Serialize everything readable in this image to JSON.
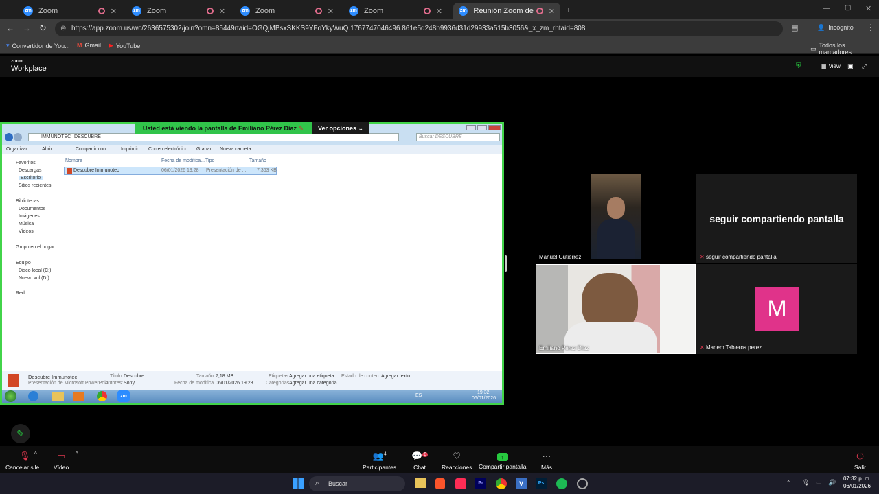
{
  "browser": {
    "tabs": [
      {
        "label": "Zoom"
      },
      {
        "label": "Zoom"
      },
      {
        "label": "Zoom"
      },
      {
        "label": "Zoom"
      },
      {
        "label": "Reunión Zoom de Manuel"
      }
    ],
    "url": "https://app.zoom.us/wc/2636575302/join?omn=85449rtaid=OGQjMBsxSKKS9YFoYkyWuQ.1767747046496.861e5d248b9936d31d29933a515b3056&_x_zm_rhtaid=808",
    "incognito_label": "Incógnito",
    "bookmarks": [
      "Convertidor de You...",
      "Gmail",
      "YouTube"
    ],
    "all_bookmarks": "Todos los marcadores"
  },
  "zoom": {
    "brand_top": "zoom",
    "brand_bottom": "Workplace",
    "view_label": "View",
    "share_banner": "Usted está viendo la pantalla de  Emiliano Pérez Díaz",
    "view_options": "Ver opciones",
    "participants": [
      {
        "name": "Manuel Gutierrez"
      },
      {
        "name": "seguir compartiendo pantalla"
      },
      {
        "name": "Emiliano Pérez Díaz"
      },
      {
        "name": "Marlem Tableros perez"
      }
    ],
    "share_tile_title": "seguir compartiendo pantalla",
    "avatar_letter": "M",
    "toolbar": {
      "mute": "Cancelar sile...",
      "video": "Vídeo",
      "participants": "Participantes",
      "participants_count": "4",
      "chat": "Chat",
      "chat_badge": "8",
      "reactions": "Reacciones",
      "share": "Compartir pantalla",
      "more": "Más",
      "leave": "Salir"
    }
  },
  "explorer": {
    "path": [
      "IMMUNOTEC",
      "DESCUBRE"
    ],
    "search_placeholder": "Buscar DESCUBRE",
    "menu": [
      "Organizar",
      "Abrir",
      "Compartir con",
      "Imprimir",
      "Correo electrónico",
      "Grabar",
      "Nueva carpeta"
    ],
    "sidebar": [
      "Favoritos",
      "Descargas",
      "Escritorio",
      "Sitios recientes",
      "Bibliotecas",
      "Documentos",
      "Imágenes",
      "Música",
      "Vídeos",
      "Grupo en el hogar",
      "Equipo",
      "Disco local (C:)",
      "Nuevo vol (D:)",
      "Red"
    ],
    "columns": [
      "Nombre",
      "Fecha de modifica...",
      "Tipo",
      "Tamaño"
    ],
    "file": {
      "name": "Descubre Immunotec",
      "date": "06/01/2026 19:28",
      "type": "Presentación de ...",
      "size": "7,363 KB"
    },
    "details": {
      "name": "Descubre Immunotec",
      "kind": "Presentación de Microsoft PowerPoint",
      "title_label": "Título:",
      "title": "Descubre",
      "authors_label": "Autores:",
      "authors": "Sony",
      "size_label": "Tamaño:",
      "size": "7,18 MB",
      "date_label": "Fecha de modifica...",
      "date": "06/01/2026 19:28",
      "tags_label": "Etiquetas:",
      "tags": "Agregar una etiqueta",
      "cat_label": "Categorías:",
      "cat": "Agregar una categoría",
      "status_label": "Estado de conten...",
      "status": "Agregar texto"
    },
    "tray": {
      "lang": "ES",
      "time": "19:32",
      "date": "06/01/2026"
    }
  },
  "windows": {
    "search": "Buscar",
    "time": "07:32 p. m.",
    "date": "06/01/2026"
  }
}
